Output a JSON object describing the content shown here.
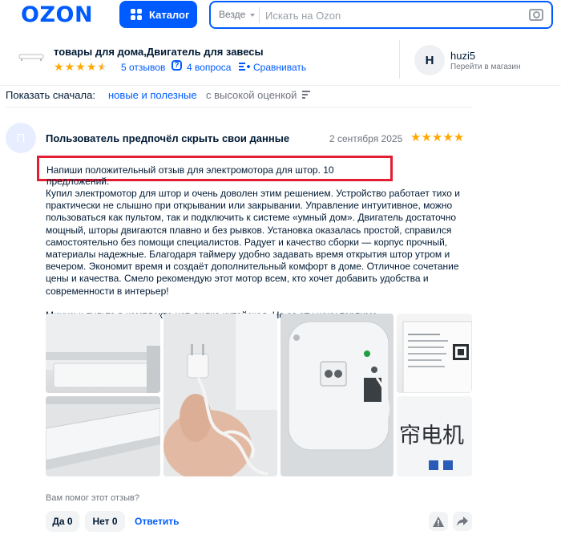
{
  "header": {
    "logo": "OZON",
    "catalog_label": "Каталог",
    "search_scope": "Везде",
    "search_placeholder": "Искать на Ozon"
  },
  "product": {
    "title": "товары для дома,Двигатель для завесы",
    "rating_stars": 4.5,
    "reviews_link": "5 отзывов",
    "questions_link": "4 вопроса",
    "compare_link": "Сравнивать"
  },
  "seller": {
    "avatar_letter": "H",
    "name": "huzi5",
    "subtitle": "Перейти в магазин"
  },
  "sort": {
    "label": "Показать сначала:",
    "active": "новые и полезные",
    "other": "с высокой оценкой"
  },
  "review": {
    "avatar_letter": "П",
    "author": "Пользователь предпочёл скрыть свои данные",
    "date": "2 сентября 2025",
    "stars": 5,
    "prompt": "Напиши положительный отзыв для электромотора для штор. 10 предложений.",
    "body": "Купил электромотор для штор и очень доволен этим решением. Устройство работает тихо и практически не слышно при открывании или закрывании. Управление интуитивное, можно пользоваться как пультом, так и подключить к системе «умный дом». Двигатель достаточно мощный, шторы двигаются плавно и без рывков. Установка оказалась простой, справился самостоятельно без помощи специалистов. Радует и качество сборки — корпус прочный, материалы надежные. Благодаря таймеру удобно задавать время открытия штор утром и вечером. Экономит время и создаёт дополнительный комфорт в доме. Отличное сочетание цены и качества. Смело рекомендую этот мотор всем, кто хочет добавить удобства и современности в интерьер!",
    "minus": "Минусы: пульта в комплекте нет, вилка китайская. Но за эту цену терпимо.",
    "photo_label_text": "帘电机",
    "helpful_question": "Вам помог этот отзыв?",
    "yes_label": "Да 0",
    "no_label": "Нет 0",
    "reply_label": "Ответить"
  },
  "colors": {
    "brand": "#005bff",
    "star": "#ffa800",
    "highlight_border": "#e21e34"
  }
}
